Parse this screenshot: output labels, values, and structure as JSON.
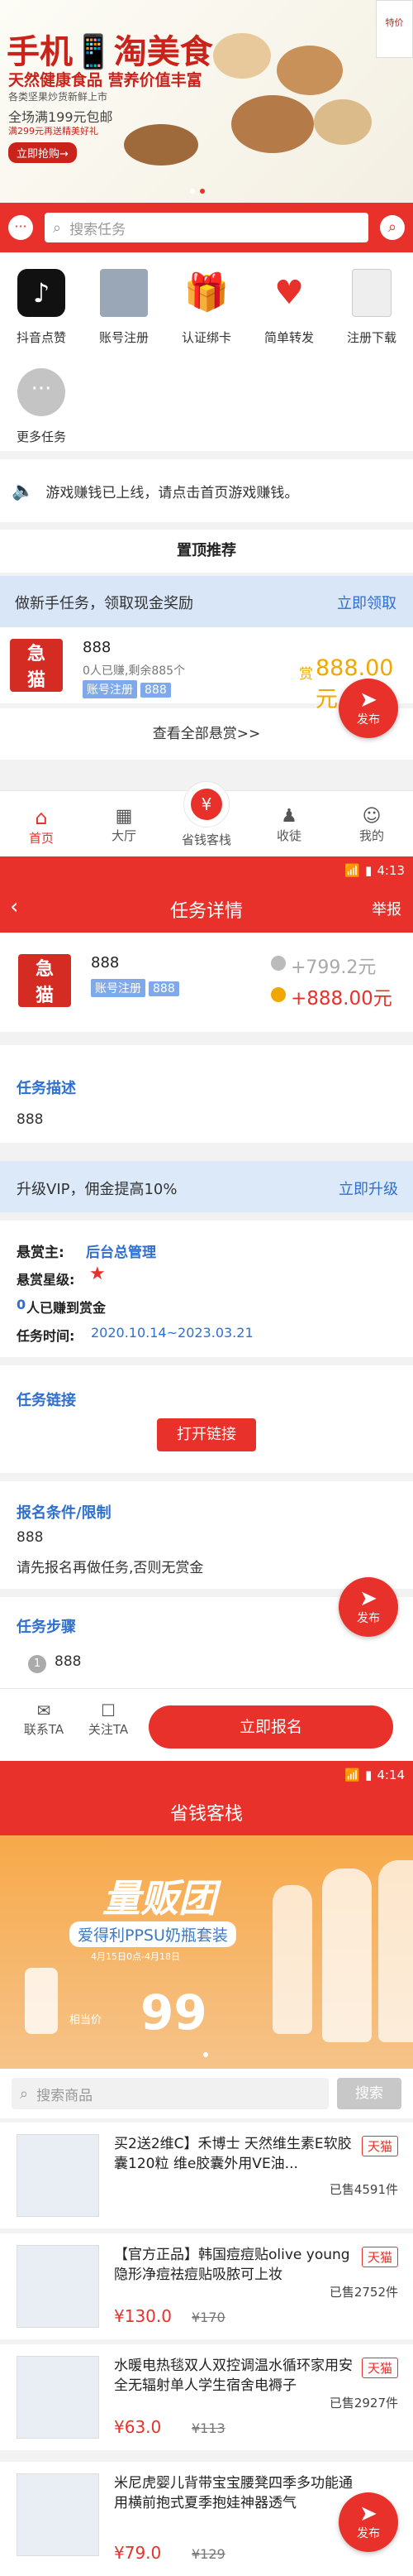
{
  "screen1": {
    "banner": {
      "title": "手机📱淘美食",
      "subtitle": "天然健康食品 营养价值丰富",
      "desc": "各类坚果炒货新鲜上市",
      "promo": "全场满199元包邮",
      "promo2": "满299元再送精美好礼",
      "button": "立即抢购→",
      "ribbon": "特价"
    },
    "search_placeholder": "搜索任务",
    "categories": [
      {
        "label": "抖音点赞",
        "icon": "tiktok-icon"
      },
      {
        "label": "账号注册",
        "icon": "register-icon"
      },
      {
        "label": "认证绑卡",
        "icon": "gift-icon"
      },
      {
        "label": "简单转发",
        "icon": "heart-chat-icon"
      },
      {
        "label": "注册下载",
        "icon": "download-icon"
      },
      {
        "label": "更多任务",
        "icon": "more-icon"
      }
    ],
    "notice": "游戏赚钱已上线，请点击首页游戏赚钱。",
    "pinned_title": "置顶推荐",
    "newbie": {
      "text": "做新手任务，领取现金奖励",
      "action": "立即领取"
    },
    "task": {
      "name": "888",
      "stats": "0人已赚,剩余885个",
      "tags": [
        "账号注册",
        "888"
      ],
      "reward_label": "赏",
      "reward": "888.00元"
    },
    "view_all": "查看全部悬赏>>",
    "fab_label": "发布",
    "tabbar": [
      {
        "label": "首页",
        "icon": "home-icon"
      },
      {
        "label": "大厅",
        "icon": "hall-icon"
      },
      {
        "label": "省钱客栈",
        "icon": "coupon-icon"
      },
      {
        "label": "收徒",
        "icon": "apprentice-icon"
      },
      {
        "label": "我的",
        "icon": "profile-icon"
      }
    ]
  },
  "screen2": {
    "time": "4:13",
    "title": "任务详情",
    "report": "举报",
    "task": {
      "name": "888",
      "tags": [
        "账号注册",
        "888"
      ],
      "price_gray": "+799.2元",
      "price_red": "+888.00元"
    },
    "desc_title": "任务描述",
    "desc": "888",
    "vip": {
      "text": "升级VIP，佣金提高10%",
      "action": "立即升级"
    },
    "publisher_label": "悬赏主:",
    "publisher": "后台总管理",
    "star_label": "悬赏星级:",
    "earned_count": "0",
    "earned_text": "人已赚到赏金",
    "time_label": "任务时间:",
    "time_range": "2020.10.14~2023.03.21",
    "link_title": "任务链接",
    "open_link": "打开链接",
    "cond_title": "报名条件/限制",
    "cond_value": "888",
    "cond_text": "请先报名再做任务,否则无赏金",
    "steps_title": "任务步骤",
    "step1": "888",
    "fab_label": "发布",
    "contact": "联系TA",
    "follow": "关注TA",
    "signup": "立即报名"
  },
  "screen3": {
    "time": "4:14",
    "title": "省钱客栈",
    "banner": {
      "big": "量贩团",
      "line": "爱得利PPSU奶瓶套装",
      "date": "4月15日0点-4月18日",
      "price": "99",
      "price_label": "相当价"
    },
    "search_placeholder": "搜索商品",
    "search_button": "搜索",
    "products": [
      {
        "name": "买2送2维C】禾博士 天然维生素E软胶囊120粒 维e胶囊外用VE油...",
        "sold": "已售4591件",
        "price": "",
        "orig": "",
        "tag": "天猫"
      },
      {
        "name": "【官方正品】韩国痘痘贴olive young隐形净痘祛痘贴吸脓可上妆",
        "sold": "已售2752件",
        "price": "¥130.0",
        "orig": "¥170",
        "tag": "天猫"
      },
      {
        "name": "水暖电热毯双人双控调温水循环家用安全无辐射单人学生宿舍电褥子",
        "sold": "已售2927件",
        "price": "¥63.0",
        "orig": "¥113",
        "tag": "天猫"
      },
      {
        "name": "米尼虎婴儿背带宝宝腰凳四季多功能通用横前抱式夏季抱娃神器透气",
        "sold": "",
        "price": "¥79.0",
        "orig": "¥129",
        "tag": "天猫"
      }
    ],
    "fab_label": "发布"
  },
  "colors": {
    "brand_red": "#e8312a",
    "tag_blue": "#7fa9ea",
    "link_blue": "#2f6fd0",
    "gold": "#f0a800"
  }
}
